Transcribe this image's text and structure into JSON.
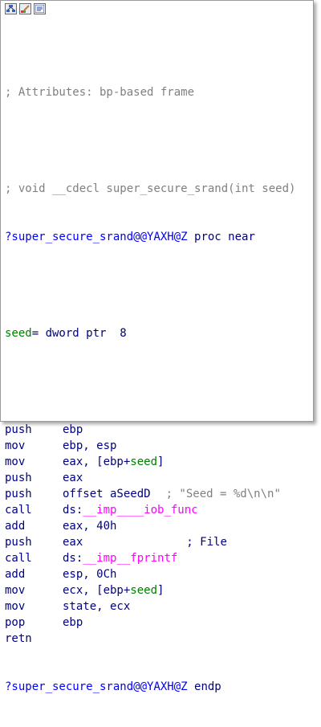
{
  "toolbar": {
    "icons": [
      "graph-view-icon",
      "pencil-color-icon",
      "text-view-icon"
    ]
  },
  "listing": {
    "comment_frame": "; Attributes: bp-based frame",
    "comment_proto": "; void __cdecl super_secure_srand(int seed)",
    "proc_name": "?super_secure_srand@@YAXH@Z",
    "proc_kw": "proc near",
    "seed_label": "seed",
    "seed_def": "= dword ptr  8",
    "instructions": [
      {
        "mn": "push",
        "a": "ebp"
      },
      {
        "mn": "mov",
        "a": "ebp, esp"
      },
      {
        "mn": "mov",
        "a": "eax, [ebp+",
        "b": "seed",
        "c": "]"
      },
      {
        "mn": "push",
        "a": "eax"
      },
      {
        "mn": "push",
        "a": "offset aSeedD",
        "cm": "; \"Seed = %d\\n\\n\""
      },
      {
        "mn": "call",
        "a": "ds:",
        "m": "__imp____iob_func"
      },
      {
        "mn": "add",
        "a": "eax, 40h"
      },
      {
        "mn": "push",
        "a": "eax",
        "cm": "; File"
      },
      {
        "mn": "call",
        "a": "ds:",
        "m": "__imp__fprintf"
      },
      {
        "mn": "add",
        "a": "esp, 0Ch"
      },
      {
        "mn": "mov",
        "a": "ecx, [ebp+",
        "b": "seed",
        "c": "]"
      },
      {
        "mn": "mov",
        "a": "state, ecx"
      },
      {
        "mn": "pop",
        "a": "ebp"
      },
      {
        "mn": "retn",
        "a": ""
      }
    ],
    "endp_name": "?super_secure_srand@@YAXH@Z",
    "endp_kw": "endp"
  },
  "colors": {
    "instruction": "#000080",
    "comment": "#808080",
    "proc_name": "#0000ff",
    "variable": "#008000",
    "import": "#ff00ff"
  }
}
